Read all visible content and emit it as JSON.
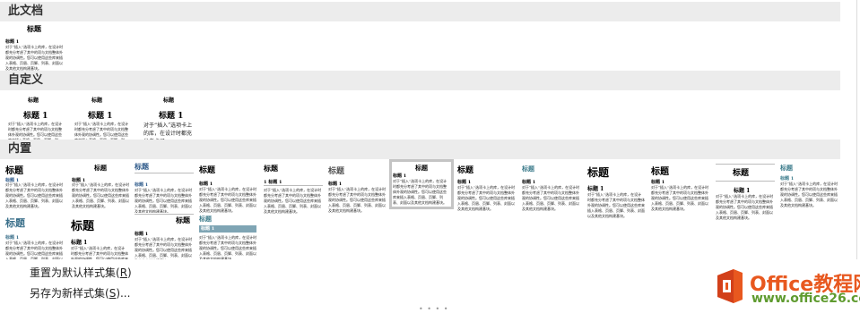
{
  "sections": {
    "this_document": "此文档",
    "custom": "自定义",
    "builtin": "内置"
  },
  "thumb_text": {
    "title": "标题",
    "heading1": "标题 1",
    "heading1_num": "1 标题 1",
    "body": "对于“插入”选项卡上的库，在设计时都充分考虑了其中的项与文档整体外观的协调性。您可以使用这些库来插入表格、页眉、页脚、列表、封面以及其他文档构建基块。",
    "body_custom3": "对于“插入”选项卡上的库，在设计时都充分考虑了"
  },
  "menu": {
    "reset_label": "重置为默认样式集(",
    "reset_key": "R",
    "reset_close": ")",
    "save_label": "另存为新样式集(",
    "save_key": "S",
    "save_close": ")..."
  },
  "resize_handle": "• • • •",
  "logo": {
    "title": "Office教程网",
    "url": "www.office26.com",
    "accent_color": "#e8581f"
  }
}
